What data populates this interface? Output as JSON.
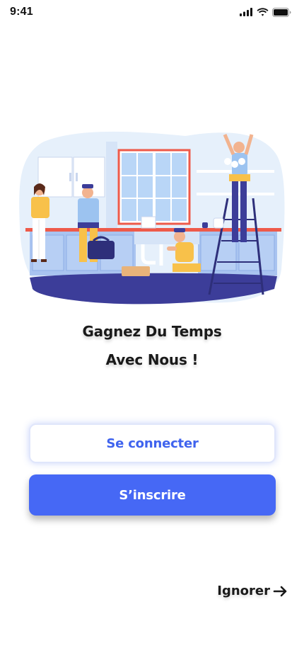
{
  "status_bar": {
    "time": "9:41",
    "icons": [
      "cellular-signal-icon",
      "wifi-icon",
      "battery-icon"
    ]
  },
  "illustration": {
    "description_icon": "home-repair-workers-illustration"
  },
  "headline": {
    "line1": "Gagnez Du Temps",
    "line2": "Avec Nous !"
  },
  "actions": {
    "login_label": "Se connecter",
    "signup_label": "S’inscrire",
    "skip_label": "Ignorer"
  },
  "colors": {
    "primary": "#4668f5",
    "login_text": "#3f63ee",
    "illustration_bg": "#e6f0fb",
    "floor": "#3c3d99"
  }
}
